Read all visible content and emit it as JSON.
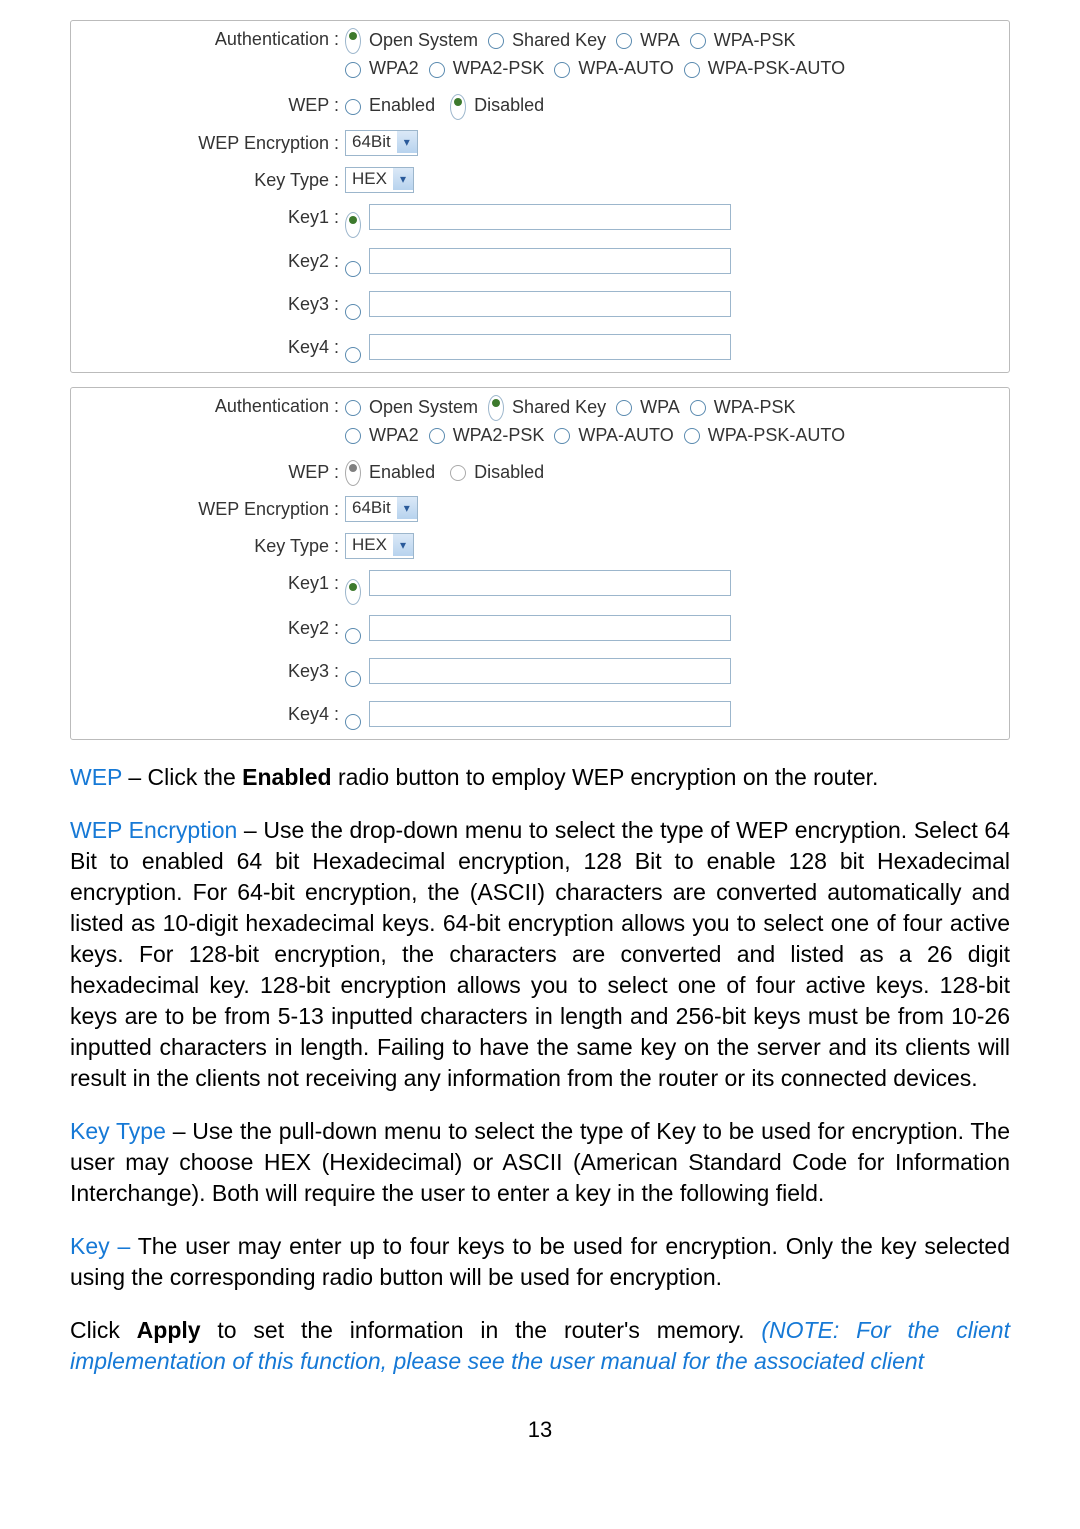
{
  "panel1": {
    "auth_label": "Authentication :",
    "opts": [
      "Open System",
      "Shared Key",
      "WPA",
      "WPA-PSK",
      "WPA2",
      "WPA2-PSK",
      "WPA-AUTO",
      "WPA-PSK-AUTO"
    ],
    "auth_sel": 0,
    "wep_label": "WEP :",
    "wep_en": "Enabled",
    "wep_dis": "Disabled",
    "wep_sel": 1,
    "wepenc_label": "WEP Encryption :",
    "wepenc_val": "64Bit",
    "keytype_label": "Key Type :",
    "keytype_val": "HEX",
    "key1": "Key1 :",
    "key2": "Key2 :",
    "key3": "Key3 :",
    "key4": "Key4 :",
    "key_sel": 0
  },
  "panel2": {
    "auth_label": "Authentication :",
    "opts": [
      "Open System",
      "Shared Key",
      "WPA",
      "WPA-PSK",
      "WPA2",
      "WPA2-PSK",
      "WPA-AUTO",
      "WPA-PSK-AUTO"
    ],
    "auth_sel": 1,
    "wep_label": "WEP :",
    "wep_en": "Enabled",
    "wep_dis": "Disabled",
    "wep_sel": 0,
    "wep_disabled": true,
    "wepenc_label": "WEP Encryption :",
    "wepenc_val": "64Bit",
    "keytype_label": "Key Type :",
    "keytype_val": "HEX",
    "key1": "Key1 :",
    "key2": "Key2 :",
    "key3": "Key3 :",
    "key4": "Key4 :",
    "key_sel": 0
  },
  "body": {
    "p1_term": "WEP",
    "p1_a": " – Click the ",
    "p1_b": "Enabled",
    "p1_c": " radio button to employ WEP encryption on the router.",
    "p2_term": "WEP Encryption",
    "p2": " – Use the drop-down menu to select the type of WEP encryption. Select 64 Bit to enabled 64 bit Hexadecimal encryption, 128 Bit to enable 128 bit Hexadecimal encryption. For 64-bit encryption, the (ASCII) characters are converted automatically and listed as 10-digit hexadecimal keys. 64-bit encryption allows you to select one of four active keys. For 128-bit encryption, the characters are converted and listed as a 26 digit hexadecimal key. 128-bit encryption allows you to select one of four active keys. 128-bit keys are to be from 5-13 inputted characters in length and 256-bit keys must be from 10-26 inputted characters in length. Failing to have the same key on the server and its clients will result in the clients not receiving any information from the router or its connected devices.",
    "p3_term": "Key Type",
    "p3": " – Use the pull-down menu to select the type of Key to be used for encryption. The user may choose HEX (Hexidecimal) or ASCII (American Standard Code for Information Interchange). Both will require the user to enter a key in the following field.",
    "p4_term": "Key –",
    "p4": " The user may enter up to four keys to be used for encryption. Only the key selected using the corresponding radio button will be used for encryption.",
    "p5_a": "Click ",
    "p5_b": "Apply",
    "p5_c": " to set the information in the router's memory. ",
    "p5_note": "(NOTE: For the client implementation of this function, please see the user manual for the associated client",
    "page_num": "13"
  }
}
